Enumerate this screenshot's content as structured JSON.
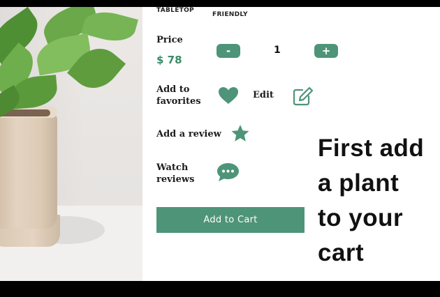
{
  "tags": {
    "tabletop": "TABLETOP",
    "friendly": "FRIENDLY"
  },
  "price": {
    "label": "Price",
    "value": "$ 78"
  },
  "quantity": {
    "decrement_label": "-",
    "value": "1",
    "increment_label": "+"
  },
  "favorites": {
    "label_line1": "Add to",
    "label_line2": "favorites"
  },
  "edit": {
    "label": "Edit"
  },
  "review": {
    "label": "Add a review"
  },
  "watch": {
    "label_line1": "Watch",
    "label_line2": "reviews"
  },
  "cart_button": {
    "label": "Add to Cart"
  },
  "hint": {
    "lines": [
      "First add",
      "a plant",
      "to your",
      "cart"
    ]
  },
  "colors": {
    "accent": "#4e9479",
    "price": "#3a8a66"
  },
  "icons": {
    "favorite": "heart-icon",
    "edit": "edit-icon",
    "review": "star-icon",
    "watch": "chat-bubble-icon"
  }
}
